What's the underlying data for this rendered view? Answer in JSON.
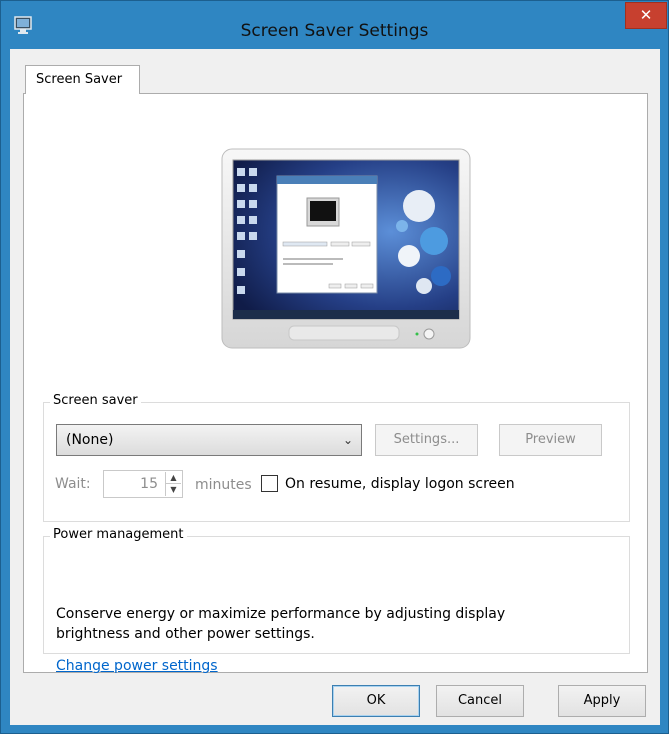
{
  "window": {
    "title": "Screen Saver Settings",
    "close_glyph": "✕",
    "accent": "#2f86c2",
    "close_color": "#c7402f"
  },
  "tabs": [
    {
      "label": "Screen Saver",
      "selected": true
    }
  ],
  "screen_saver_group": {
    "label": "Screen saver",
    "selected_value": "(None)",
    "settings_button": "Settings...",
    "preview_button": "Preview",
    "wait_label": "Wait:",
    "wait_value": "15",
    "minutes_label": "minutes",
    "logon_checkbox_label": "On resume, display logon screen",
    "logon_checked": false
  },
  "power_group": {
    "label": "Power management",
    "description": "Conserve energy or maximize performance by adjusting display brightness and other power settings.",
    "link": "Change power settings"
  },
  "footer": {
    "ok": "OK",
    "cancel": "Cancel",
    "apply": "Apply"
  },
  "icons": {
    "title_icon": "screen-saver-icon",
    "preview": "monitor-preview-icon"
  }
}
